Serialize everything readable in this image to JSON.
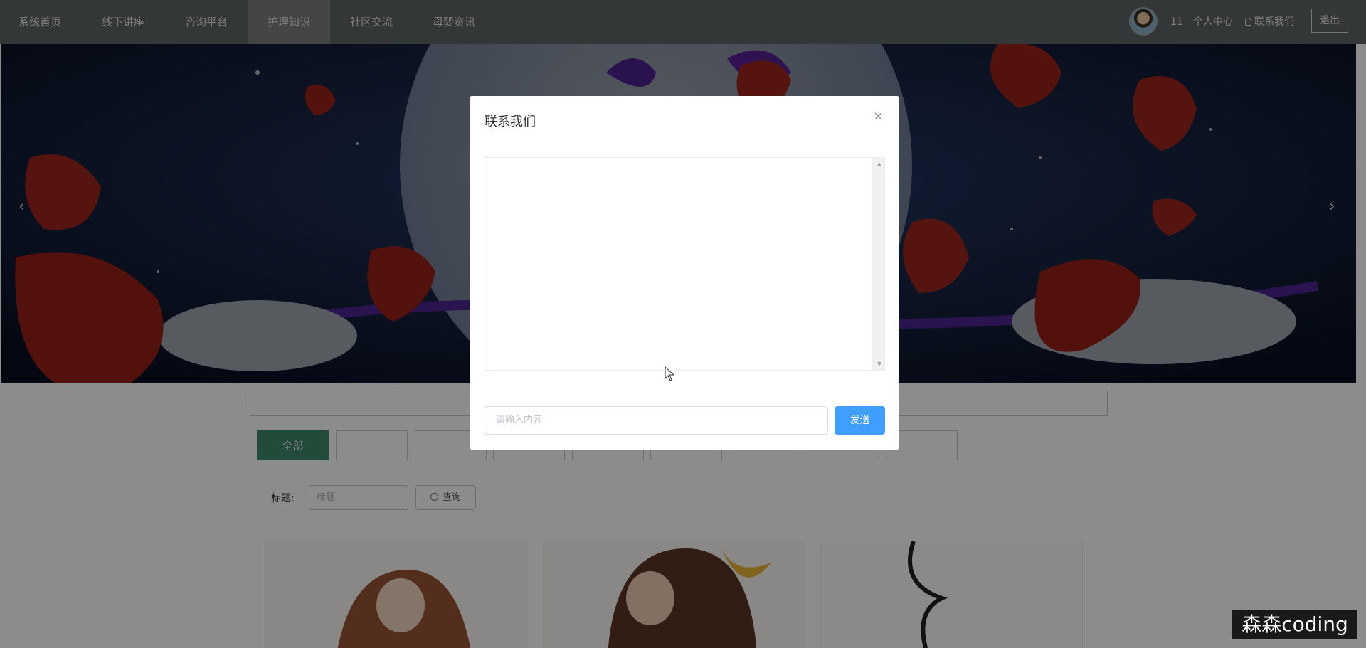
{
  "nav": {
    "items": [
      {
        "label": "系统首页",
        "active": false
      },
      {
        "label": "线下讲座",
        "active": false
      },
      {
        "label": "咨询平台",
        "active": false
      },
      {
        "label": "护理知识",
        "active": true
      },
      {
        "label": "社区交流",
        "active": false
      },
      {
        "label": "母婴资讯",
        "active": false
      }
    ],
    "username": "11",
    "profile_label": "个人中心",
    "contact_label": "联系我们",
    "logout_label": "退出"
  },
  "filters": {
    "categories_active_label": "全部",
    "title_label": "标题:",
    "title_placeholder": "标题",
    "query_label": "查询"
  },
  "modal": {
    "title": "联系我们",
    "input_placeholder": "请输入内容",
    "send_label": "发送",
    "close_symbol": "×"
  },
  "colors": {
    "active_category": "#3e8a6a",
    "send_button": "#409eff",
    "navbar": "#5f6467"
  },
  "watermark": "森森coding"
}
